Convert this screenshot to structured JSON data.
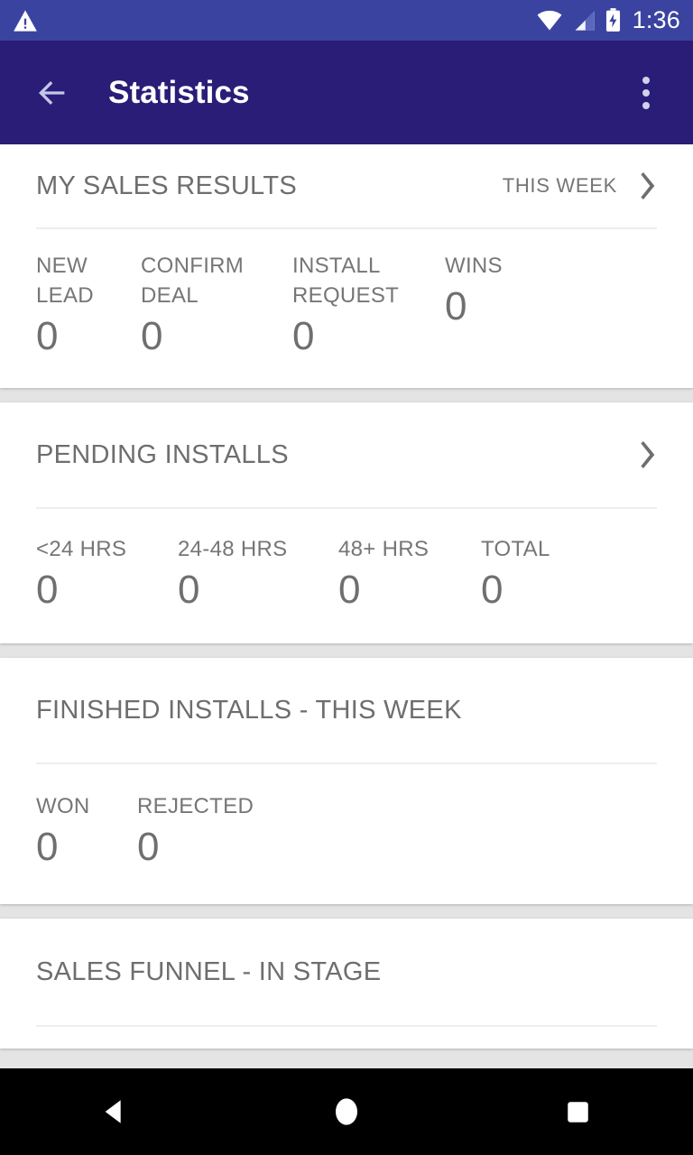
{
  "status_bar": {
    "warning_icon": "warning-triangle-icon",
    "wifi_icon": "wifi-icon",
    "signal_icon": "cellular-signal-icon",
    "battery_icon": "battery-charging-icon",
    "time": "1:36",
    "background_color": "#3a44a0"
  },
  "app_bar": {
    "back_icon": "back-arrow-icon",
    "title": "Statistics",
    "overflow_icon": "overflow-menu-icon",
    "background_color": "#2a1d78",
    "title_color": "#ffffff"
  },
  "cards": [
    {
      "id": "my-sales-results",
      "title": "MY SALES RESULTS",
      "period": "THIS WEEK",
      "chevron_icon": "chevron-right-icon",
      "stats": [
        {
          "label": "NEW\nLEAD",
          "value": "0"
        },
        {
          "label": "CONFIRM\nDEAL",
          "value": "0"
        },
        {
          "label": "INSTALL\nREQUEST",
          "value": "0"
        },
        {
          "label": "WINS",
          "value": "0"
        }
      ]
    },
    {
      "id": "pending-installs",
      "title": "PENDING INSTALLS",
      "period": "",
      "chevron_icon": "chevron-right-icon",
      "stats": [
        {
          "label": "<24 HRS",
          "value": "0"
        },
        {
          "label": "24-48 HRS",
          "value": "0"
        },
        {
          "label": "48+ HRS",
          "value": "0"
        },
        {
          "label": "TOTAL",
          "value": "0"
        }
      ]
    },
    {
      "id": "finished-installs",
      "title": "FINISHED INSTALLS - THIS WEEK",
      "period": "",
      "chevron_icon": "",
      "stats": [
        {
          "label": "WON",
          "value": "0"
        },
        {
          "label": "REJECTED",
          "value": "0"
        }
      ]
    },
    {
      "id": "sales-funnel",
      "title": "SALES FUNNEL - IN STAGE",
      "period": "",
      "chevron_icon": "",
      "stats": []
    }
  ],
  "nav_bar": {
    "back_icon": "nav-back-triangle-icon",
    "home_icon": "nav-home-circle-icon",
    "recents_icon": "nav-recents-square-icon",
    "background_color": "#000000"
  },
  "theme": {
    "card_background": "#ffffff",
    "page_background": "#e4e4e4",
    "text_color": "#6e6e6e",
    "divider_color": "#eeeeee"
  }
}
